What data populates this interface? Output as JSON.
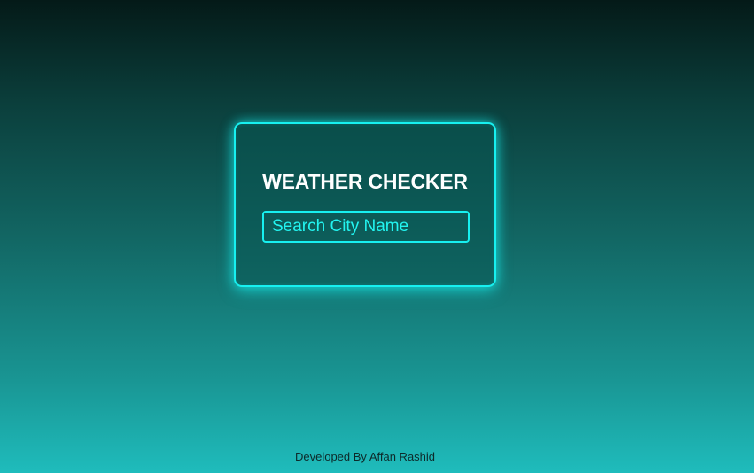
{
  "app": {
    "title": "WEATHER CHECKER"
  },
  "search": {
    "placeholder": "Search City Name",
    "value": ""
  },
  "footer": {
    "credit": "Developed By Affan Rashid"
  },
  "colors": {
    "accent": "#17f0f0",
    "background_top": "#041a18",
    "background_bottom": "#1fbcbc",
    "title_text": "#ffffff",
    "footer_text": "#0d2a2a"
  }
}
